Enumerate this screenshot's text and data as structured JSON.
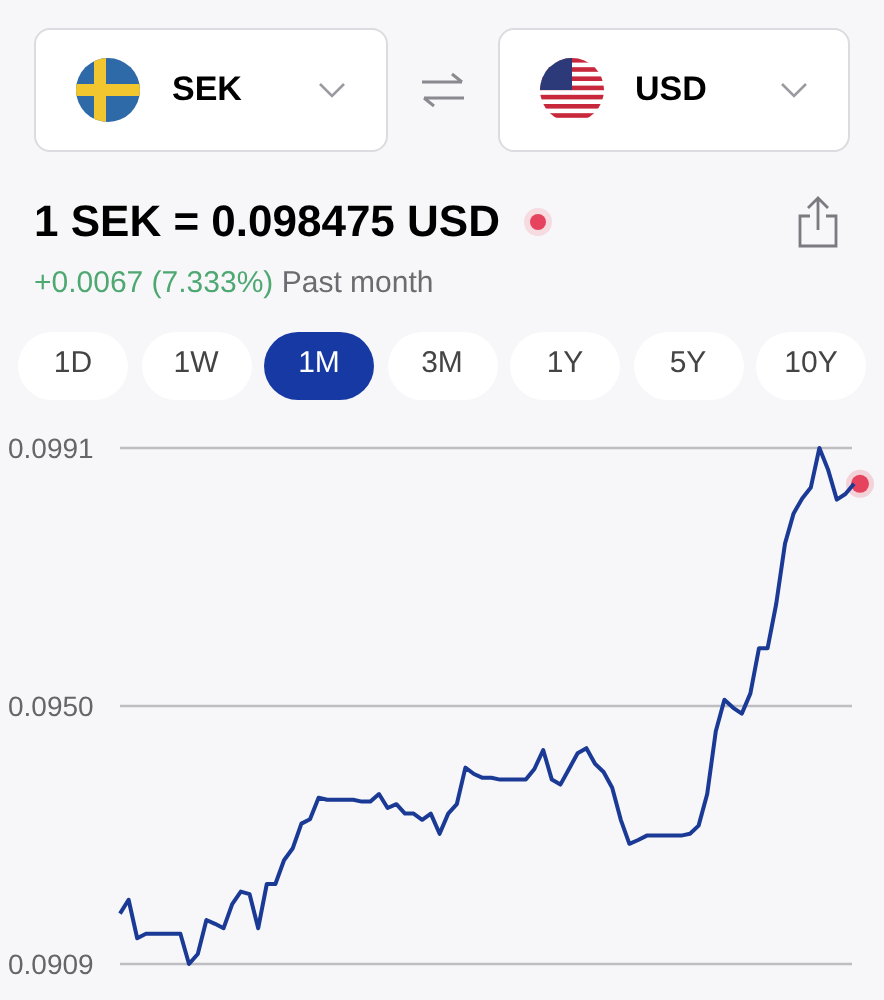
{
  "currency_pair": {
    "from": {
      "code": "SEK",
      "kind": "sweden"
    },
    "to": {
      "code": "USD",
      "kind": "usa"
    }
  },
  "rate": {
    "text": "1 SEK = 0.098475 USD",
    "live": true
  },
  "change": {
    "amount": "+0.0067 (7.333%)",
    "period": "Past month"
  },
  "ranges": [
    {
      "label": "1D",
      "selected": false
    },
    {
      "label": "1W",
      "selected": false
    },
    {
      "label": "1M",
      "selected": true
    },
    {
      "label": "3M",
      "selected": false
    },
    {
      "label": "1Y",
      "selected": false
    },
    {
      "label": "5Y",
      "selected": false
    },
    {
      "label": "10Y",
      "selected": false
    }
  ],
  "chart_data": {
    "type": "line",
    "ylim": [
      0.0909,
      0.0991
    ],
    "yticks": [
      {
        "value": 0.0909,
        "label": "0.0909"
      },
      {
        "value": 0.095,
        "label": "0.0950"
      },
      {
        "value": 0.0991,
        "label": "0.0991"
      }
    ],
    "series": [
      {
        "color": "#1a3a96",
        "values": [
          0.0917,
          0.09192,
          0.09131,
          0.09138,
          0.09138,
          0.09138,
          0.09138,
          0.09138,
          0.0909,
          0.09106,
          0.0916,
          0.09154,
          0.09147,
          0.09185,
          0.09205,
          0.09201,
          0.09147,
          0.09217,
          0.09217,
          0.09255,
          0.09274,
          0.09313,
          0.0932,
          0.09354,
          0.09351,
          0.09351,
          0.09351,
          0.09351,
          0.09348,
          0.09348,
          0.0936,
          0.09338,
          0.09344,
          0.09329,
          0.09329,
          0.09319,
          0.09329,
          0.09297,
          0.09329,
          0.09344,
          0.09402,
          0.09392,
          0.09386,
          0.09386,
          0.09383,
          0.09383,
          0.09383,
          0.09383,
          0.094,
          0.0943,
          0.09383,
          0.09375,
          0.094,
          0.09425,
          0.09433,
          0.09408,
          0.09395,
          0.0937,
          0.09319,
          0.09281,
          0.09287,
          0.09294,
          0.09294,
          0.09294,
          0.09294,
          0.09294,
          0.09297,
          0.0931,
          0.0936,
          0.0946,
          0.0951,
          0.09497,
          0.09488,
          0.0952,
          0.09592,
          0.09592,
          0.09662,
          0.09758,
          0.09806,
          0.0983,
          0.09847,
          0.0991,
          0.09876,
          0.09828,
          0.09837,
          0.09853
        ]
      }
    ]
  }
}
